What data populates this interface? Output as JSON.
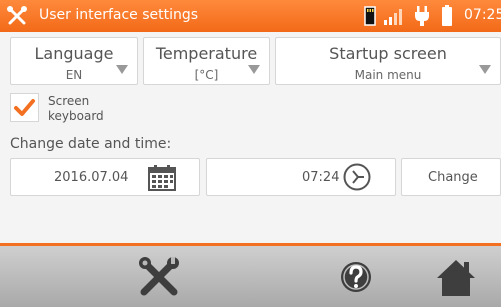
{
  "header": {
    "title": "User interface settings",
    "time": "07:25",
    "icons": [
      "tools-icon",
      "sd-card-icon",
      "signal-icon",
      "plug-icon",
      "battery-icon"
    ],
    "accent_color": "#f37021"
  },
  "settings": {
    "language": {
      "label": "Language",
      "value": "EN"
    },
    "temperature": {
      "label": "Temperature",
      "value": "[°C]"
    },
    "startup": {
      "label": "Startup screen",
      "value": "Main menu"
    },
    "screen_keyboard": {
      "label_line1": "Screen",
      "label_line2": "keyboard",
      "checked": true
    }
  },
  "datetime": {
    "title": "Change date and time:",
    "date": "2016.07.04",
    "time": "07:24",
    "change_label": "Change"
  },
  "footer": {
    "icons": [
      "settings-tools-icon",
      "help-icon",
      "home-icon"
    ]
  }
}
